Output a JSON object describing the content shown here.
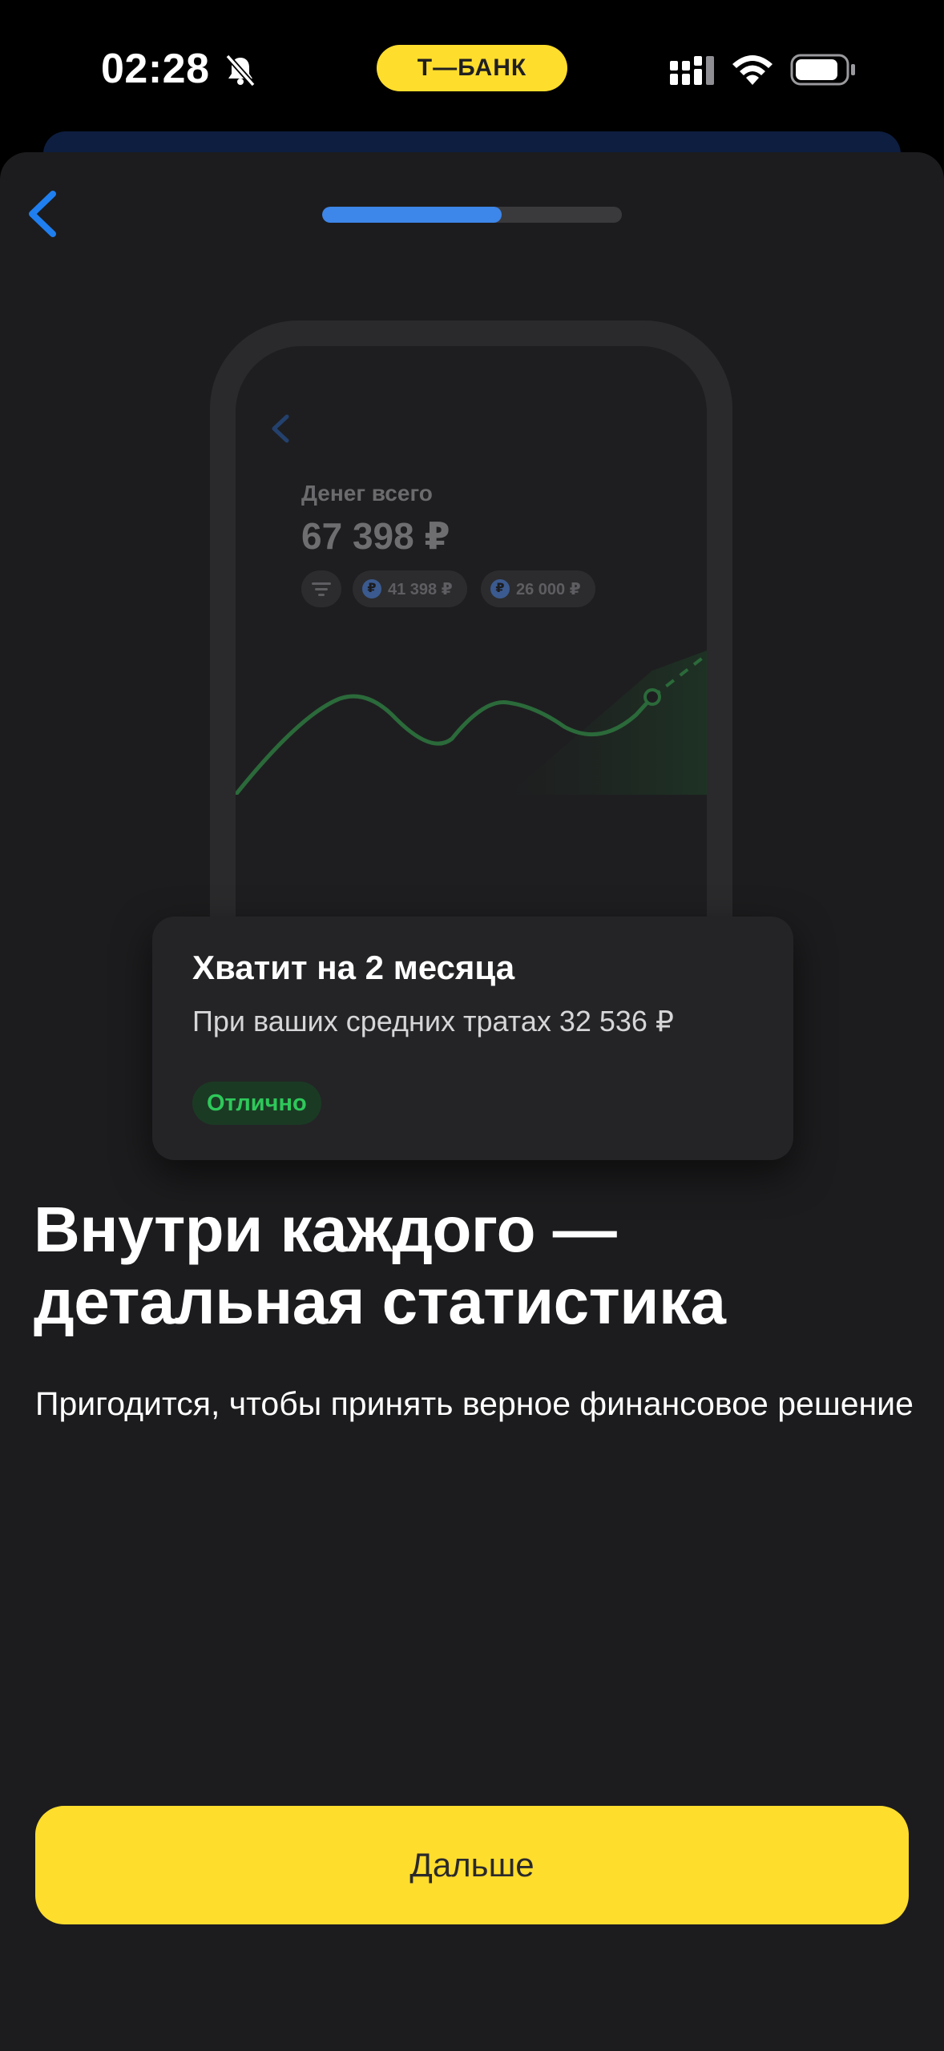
{
  "status_bar": {
    "time": "02:28",
    "brand": "Т—БАНК",
    "icons": [
      "bell-muted-icon",
      "signal-icon",
      "wifi-icon",
      "battery-icon"
    ]
  },
  "header": {
    "back_icon": "chevron-left-icon",
    "progress_fraction": 0.6
  },
  "illustration": {
    "label": "Денег всего",
    "amount": "67 398 ₽",
    "chips": [
      "41 398 ₽",
      "26 000 ₽"
    ],
    "chip_icons": [
      "filter-icon",
      "ruble-icon"
    ],
    "card": {
      "title": "Хватит на 2 месяца",
      "subtitle": "При ваших средних тратах 32 536 ₽",
      "badge": "Отлично"
    }
  },
  "content": {
    "headline_line1": "Внутри каждого —",
    "headline_line2": "детальная статистика",
    "description": "Пригодится, чтобы принять верное финансовое решение"
  },
  "footer": {
    "next_label": "Дальше"
  },
  "colors": {
    "background": "#1c1c1e",
    "accent_yellow": "#ffdd2d",
    "progress_blue": "#3d86ea",
    "success_green": "#2ec85a",
    "chevron_blue": "#1f7ff0"
  }
}
